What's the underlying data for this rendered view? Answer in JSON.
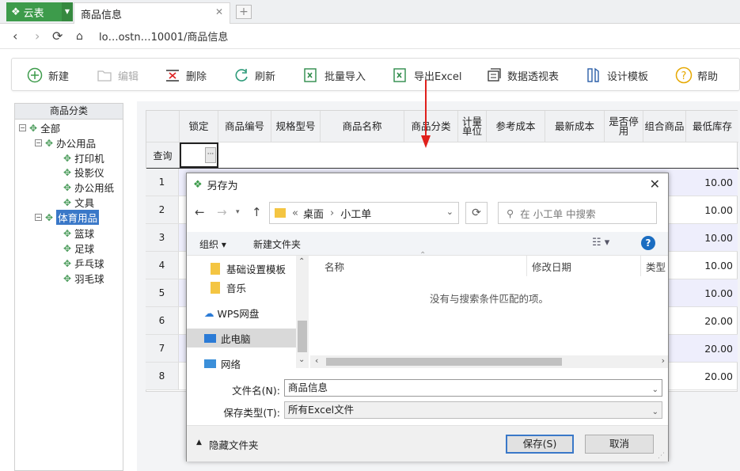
{
  "app": {
    "brand": "云表",
    "tab_title": "商品信息",
    "address": "lo…ostn…10001/商品信息"
  },
  "toolbar": [
    {
      "label": "新建",
      "icon": "plus-circle-icon",
      "enabled": true
    },
    {
      "label": "编辑",
      "icon": "folder-icon",
      "enabled": false
    },
    {
      "label": "删除",
      "icon": "delete-icon",
      "enabled": true
    },
    {
      "label": "刷新",
      "icon": "refresh-icon",
      "enabled": true
    },
    {
      "label": "批量导入",
      "icon": "import-icon",
      "enabled": true
    },
    {
      "label": "导出Excel",
      "icon": "excel-icon",
      "enabled": true
    },
    {
      "label": "数据透视表",
      "icon": "pivot-icon",
      "enabled": true
    },
    {
      "label": "设计模板",
      "icon": "design-icon",
      "enabled": true
    },
    {
      "label": "帮助",
      "icon": "help-icon",
      "enabled": true
    }
  ],
  "tree": {
    "header": "商品分类",
    "root": "全部",
    "groups": [
      {
        "label": "办公用品",
        "children": [
          "打印机",
          "投影仪",
          "办公用纸",
          "文具"
        ]
      },
      {
        "label": "体育用品",
        "selected": true,
        "children": [
          "篮球",
          "足球",
          "乒乓球",
          "羽毛球"
        ]
      }
    ]
  },
  "grid": {
    "columns": [
      "锁定",
      "商品编号",
      "规格型号",
      "商品名称",
      "商品分类",
      "计量单位",
      "参考成本",
      "最新成本",
      "是否停用",
      "组合商品",
      "最低库存"
    ],
    "query_label": "查询",
    "query_cell_button": "···",
    "rows": [
      {
        "num": "1",
        "min_stock": "10.00"
      },
      {
        "num": "2",
        "min_stock": "10.00"
      },
      {
        "num": "3",
        "min_stock": "10.00"
      },
      {
        "num": "4",
        "min_stock": "10.00"
      },
      {
        "num": "5",
        "min_stock": "10.00"
      },
      {
        "num": "6",
        "min_stock": "20.00"
      },
      {
        "num": "7",
        "min_stock": "20.00"
      },
      {
        "num": "8",
        "min_stock": "20.00"
      }
    ]
  },
  "dialog": {
    "title": "另存为",
    "path": [
      "«",
      "桌面",
      "›",
      "小工单"
    ],
    "search_placeholder": "在 小工单 中搜索",
    "organize": "组织 ▾",
    "new_folder": "新建文件夹",
    "nav_items": [
      "基础设置模板",
      "音乐",
      "WPS网盘",
      "此电脑",
      "网络"
    ],
    "columns": [
      "名称",
      "修改日期",
      "类型"
    ],
    "empty_message": "没有与搜索条件匹配的项。",
    "filename_label": "文件名(N):",
    "filename_value": "商品信息",
    "filetype_label": "保存类型(T):",
    "filetype_value": "所有Excel文件",
    "hide_folders": "隐藏文件夹",
    "save_button": "保存(S)",
    "cancel_button": "取消"
  },
  "colors": {
    "brand_green": "#3d9b4b",
    "selection_blue": "#3a78c8",
    "alt_row": "#eeeefc",
    "arrow_red": "#e0201c"
  }
}
